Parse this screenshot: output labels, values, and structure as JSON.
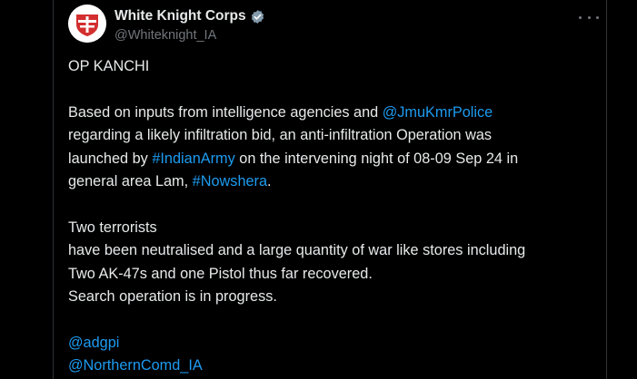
{
  "account": {
    "name": "White Knight Corps",
    "handle": "@Whiteknight_IA",
    "verified": true
  },
  "more_label": "More",
  "colors": {
    "background": "#000000",
    "text": "#e7e9ea",
    "secondary": "#71767b",
    "link": "#1d9bf0",
    "badge": "#829aab",
    "avatar_red": "#d32f2f"
  },
  "tweet": {
    "title": "OP KANCHI",
    "p1": {
      "l1_pre": "Based on inputs from intelligence agencies and ",
      "l1_mention": "@JmuKmrPolice",
      "l2": "regarding a likely infiltration bid, an anti-infiltration Operation was",
      "l3_pre": "launched by ",
      "l3_hashtag": "#IndianArmy",
      "l3_post": " on the intervening night of 08-09 Sep 24 in",
      "l4_pre": "general area Lam, ",
      "l4_hashtag": "#Nowshera",
      "l4_post": "."
    },
    "p2": {
      "l1": "Two terrorists",
      "l2": "have been neutralised and a large quantity of war like stores including",
      "l3": "Two AK-47s and one Pistol thus far recovered.",
      "l4": "Search operation is in progress."
    },
    "mentions": [
      "@adgpi",
      "@NorthernComd_IA"
    ]
  }
}
